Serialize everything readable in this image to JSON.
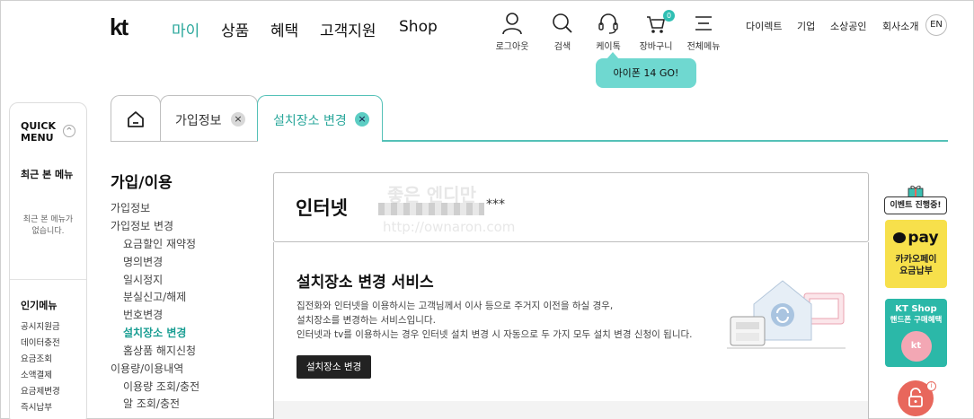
{
  "header": {
    "logo": "kt",
    "gnb": [
      "마이",
      "상품",
      "혜택",
      "고객지원",
      "Shop"
    ],
    "gnb_active": "마이",
    "util": {
      "logout": "로그아웃",
      "search": "검색",
      "chat": "케이톡",
      "cart": "장바구니",
      "cart_count": "0",
      "menu": "전체메뉴"
    },
    "toplinks": [
      "다이렉트",
      "기업",
      "소상공인",
      "회사소개"
    ],
    "lang": "EN",
    "tooltip": "아이폰 14 GO!"
  },
  "quick_menu": {
    "title_line1": "QUICK",
    "title_line2": "MENU",
    "toggle": "^",
    "recent_title": "최근 본 메뉴",
    "recent_empty_line1": "최근 본 메뉴가",
    "recent_empty_line2": "없습니다.",
    "popular_title": "인기메뉴",
    "popular_items": [
      "공시지원금",
      "데이터충전",
      "요금조회",
      "소액결제",
      "요금제변경",
      "즉시납부"
    ]
  },
  "tabs": [
    {
      "label": "",
      "icon": "home-icon"
    },
    {
      "label": "가입정보",
      "close": "×"
    },
    {
      "label": "설치장소 변경",
      "close": "×"
    }
  ],
  "lnb": {
    "title": "가입/이용",
    "items": [
      {
        "label": "가입정보",
        "level": 1
      },
      {
        "label": "가입정보 변경",
        "level": 1
      },
      {
        "label": "요금할인 재약정",
        "level": 2
      },
      {
        "label": "명의변경",
        "level": 2
      },
      {
        "label": "일시정지",
        "level": 2
      },
      {
        "label": "분실신고/해제",
        "level": 2
      },
      {
        "label": "번호변경",
        "level": 2
      },
      {
        "label": "설치장소 변경",
        "level": 2,
        "selected": true
      },
      {
        "label": "홈상품 해지신청",
        "level": 2
      },
      {
        "label": "이용량/이용내역",
        "level": 1
      },
      {
        "label": "이용량 조회/충전",
        "level": 2
      },
      {
        "label": "알 조회/충전",
        "level": 2
      }
    ]
  },
  "content": {
    "product": "인터넷",
    "product_id_suffix": "***",
    "service_title": "설치장소 변경 서비스",
    "desc1": "집전화와 인터넷을 이용하시는 고객님께서 이사 등으로 주거지 이전을 하실 경우,",
    "desc2": "설치장소를 변경하는 서비스입니다.",
    "desc3": "인터넷과 tv를 이용하시는 경우 인터넷 설치 변경 시 자동으로 두 가지 모두 설치 변경 신청이 됩니다.",
    "button": "설치장소 변경"
  },
  "banners": {
    "event_tag": "이벤트 진행중!",
    "kpay_logo": "pay",
    "kpay_line1": "카카오페이",
    "kpay_line2": "요금납부",
    "kshop_line1": "KT Shop",
    "kshop_line2": "핸드폰 구매혜택",
    "kshop_badge": "kt",
    "lock_badge": "i"
  },
  "watermark": {
    "line1": "좋은 엔디만",
    "line2": "http://ownaron.com"
  },
  "colors": {
    "accent": "#2aa79b",
    "tab_border": "#54c1b7",
    "tooltip": "#6fd8d0",
    "kpay": "#f7e04b",
    "kshop": "#2bb8a8",
    "lock": "#e8675c"
  }
}
